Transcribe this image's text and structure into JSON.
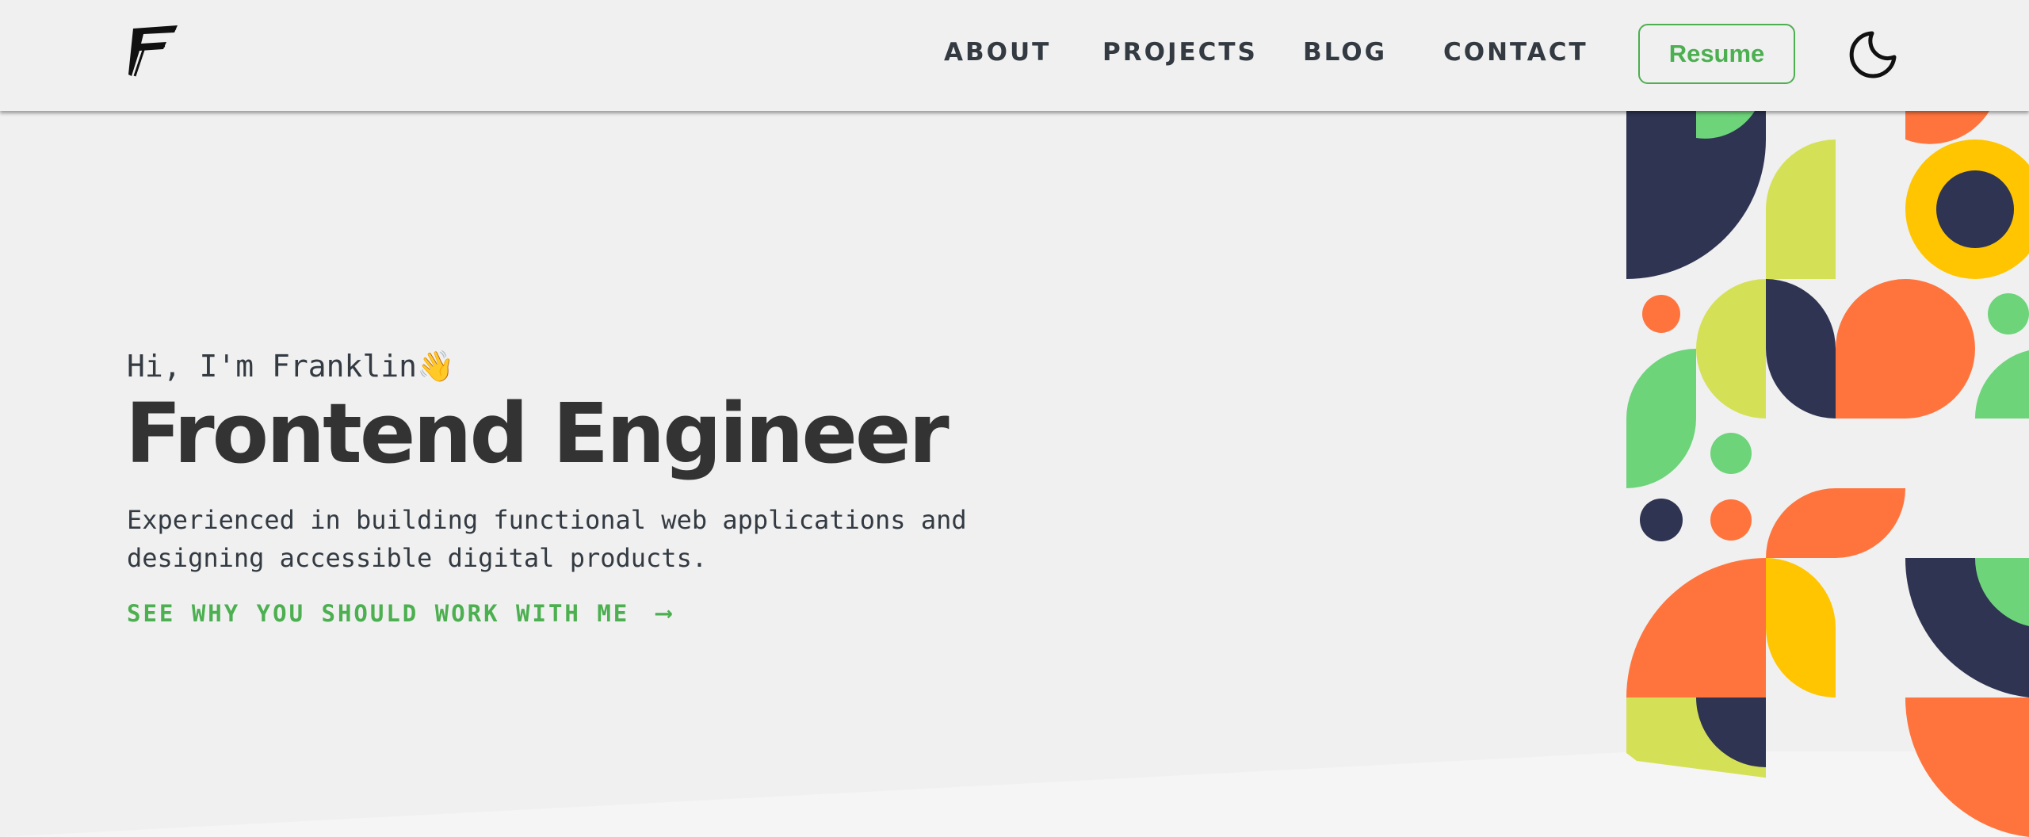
{
  "nav": {
    "items": [
      "ABOUT",
      "PROJECTS",
      "BLOG",
      "CONTACT"
    ],
    "resume_label": "Resume"
  },
  "hero": {
    "greeting": "Hi, I'm Franklin",
    "wave_emoji": "👋",
    "title": "Frontend Engineer",
    "description": "Experienced in building functional web applications and designing accessible digital products.",
    "cta_label": "SEE WHY YOU SHOULD WORK WITH ME",
    "cta_arrow": "⟶"
  },
  "icons": {
    "logo": "ff-logo",
    "theme_toggle": "moon-icon"
  },
  "colors": {
    "accent": "#4caf50",
    "text": "#333a42",
    "background": "#f0f0f0",
    "navy": "#2e3452",
    "orange": "#ff743d",
    "lime": "#d4e157",
    "green": "#6dd47a",
    "yellow": "#ffc500"
  }
}
